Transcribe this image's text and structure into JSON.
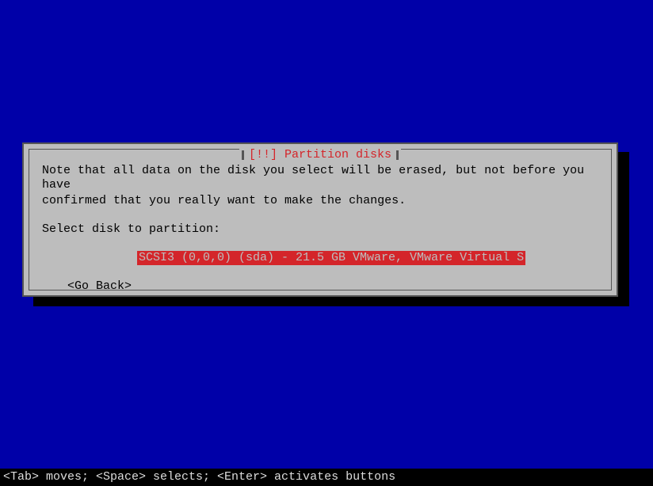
{
  "dialog": {
    "title": "[!!] Partition disks",
    "note_line1": "Note that all data on the disk you select will be erased, but not before you have",
    "note_line2": "confirmed that you really want to make the changes.",
    "prompt": "Select disk to partition:",
    "disks": [
      "SCSI3 (0,0,0) (sda) - 21.5 GB VMware, VMware Virtual S"
    ],
    "go_back": "<Go Back>"
  },
  "statusbar": {
    "text": "<Tab> moves; <Space> selects; <Enter> activates buttons"
  },
  "colors": {
    "background": "#0000a8",
    "dialog_bg": "#bdbdbd",
    "accent_red": "#d4252a"
  }
}
